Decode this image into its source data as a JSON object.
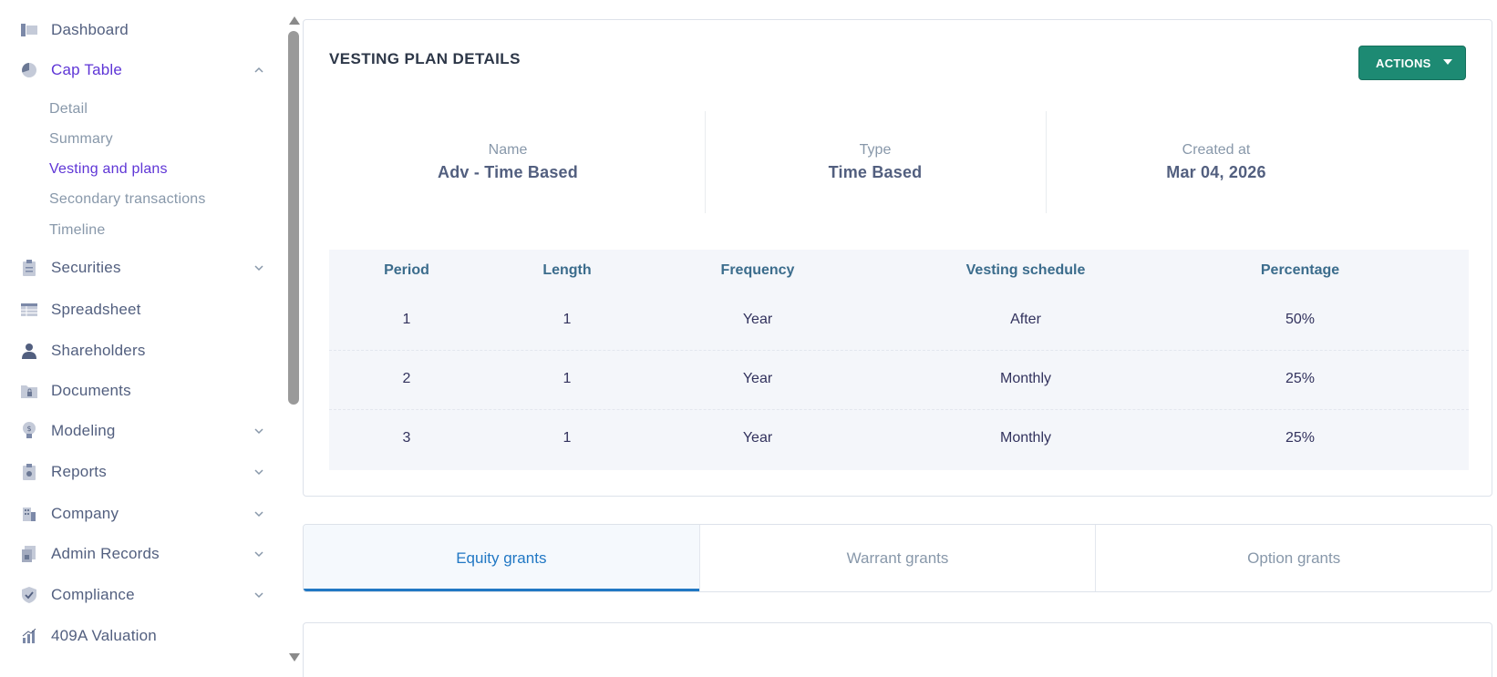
{
  "sidebar": {
    "items": [
      {
        "label": "Dashboard",
        "icon": "dashboard-icon"
      },
      {
        "label": "Cap Table",
        "icon": "pie-chart-icon",
        "expanded": true
      },
      {
        "label": "Securities",
        "icon": "clipboard-icon"
      },
      {
        "label": "Spreadsheet",
        "icon": "table-icon"
      },
      {
        "label": "Shareholders",
        "icon": "person-icon"
      },
      {
        "label": "Documents",
        "icon": "folder-lock-icon"
      },
      {
        "label": "Modeling",
        "icon": "lightbulb-icon"
      },
      {
        "label": "Reports",
        "icon": "report-icon"
      },
      {
        "label": "Company",
        "icon": "building-icon"
      },
      {
        "label": "Admin Records",
        "icon": "admin-records-icon"
      },
      {
        "label": "Compliance",
        "icon": "shield-check-icon"
      },
      {
        "label": "409A Valuation",
        "icon": "bar-chart-icon"
      }
    ],
    "cap_table_sub": [
      "Detail",
      "Summary",
      "Vesting and plans",
      "Secondary transactions",
      "Timeline"
    ],
    "active_sub": "Vesting and plans",
    "accent_color": "#5e35d6"
  },
  "card": {
    "title": "VESTING PLAN DETAILS",
    "actions_label": "ACTIONS",
    "actions_color": "#1d8a73",
    "info": [
      {
        "key": "Name",
        "value": "Adv - Time Based"
      },
      {
        "key": "Type",
        "value": "Time Based"
      },
      {
        "key": "Created at",
        "value": "Mar 04, 2026"
      }
    ]
  },
  "table": {
    "headers": [
      "Period",
      "Length",
      "Frequency",
      "Vesting schedule",
      "Percentage"
    ],
    "rows": [
      [
        "1",
        "1",
        "Year",
        "After",
        "50%"
      ],
      [
        "2",
        "1",
        "Year",
        "Monthly",
        "25%"
      ],
      [
        "3",
        "1",
        "Year",
        "Monthly",
        "25%"
      ]
    ]
  },
  "tabs": [
    {
      "label": "Equity grants",
      "active": true
    },
    {
      "label": "Warrant grants",
      "active": false
    },
    {
      "label": "Option grants",
      "active": false
    }
  ],
  "tab_accent_color": "#2178c4"
}
